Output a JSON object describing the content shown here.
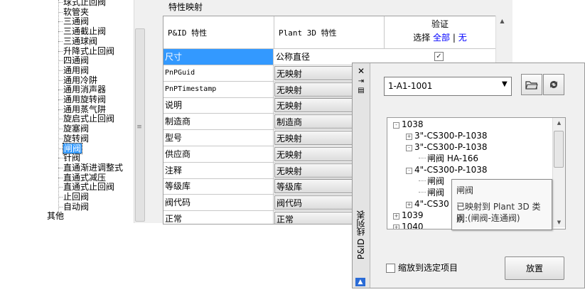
{
  "tree": {
    "items": [
      "球式止回阀",
      "软管夹",
      "三通阀",
      "三通截止阀",
      "三通球阀",
      "升降式止回阀",
      "四通阀",
      "通用阀",
      "通用冷阱",
      "通用消声器",
      "通用旋转阀",
      "通用蒸气阱",
      "旋启式止回阀",
      "旋塞阀",
      "旋转阀",
      "闸阀",
      "针阀",
      "直通渐进调整式",
      "直通式减压",
      "直通式止回阀",
      "止回阀",
      "自动阀",
      "其他"
    ],
    "selected_index": 15
  },
  "properties": {
    "section_title": "特性映射",
    "col_pid": "P&ID 特性",
    "col_plant": "Plant 3D 特性",
    "col_verify": "验证",
    "select_label": "选择",
    "select_all": "全部",
    "sep": "|",
    "select_none": "无",
    "rows": [
      {
        "pid": "尺寸",
        "plant": "公称直径",
        "checked": true
      },
      {
        "pid": "PnPGuid",
        "plant": "无映射"
      },
      {
        "pid": "PnPTimestamp",
        "plant": "无映射"
      },
      {
        "pid": "说明",
        "plant": "无映射"
      },
      {
        "pid": "制造商",
        "plant": "制造商"
      },
      {
        "pid": "型号",
        "plant": "无映射"
      },
      {
        "pid": "供应商",
        "plant": "无映射"
      },
      {
        "pid": "注释",
        "plant": "无映射"
      },
      {
        "pid": "等级库",
        "plant": "等级库"
      },
      {
        "pid": "阀代码",
        "plant": "阀代码"
      },
      {
        "pid": "正常",
        "plant": "正常"
      }
    ]
  },
  "palette": {
    "title": "P&ID 线列表",
    "close_glyph": "✕",
    "drawing_select": "1-A1-1001",
    "tree": [
      {
        "label": "1038",
        "box": "-",
        "level": 0
      },
      {
        "label": "3\"-CS300-P-1038",
        "box": "+",
        "level": 1
      },
      {
        "label": "3\"-CS300-P-1038",
        "box": "-",
        "level": 1
      },
      {
        "label": "闸阀 HA-166",
        "box": "",
        "level": 2
      },
      {
        "label": "4\"-CS300-P-1038",
        "box": "-",
        "level": 1
      },
      {
        "label": "闸阀",
        "box": "",
        "level": 2
      },
      {
        "label": "闸阀",
        "box": "",
        "level": 2
      },
      {
        "label": "4\"-CS30",
        "box": "+",
        "level": 1
      },
      {
        "label": "1039",
        "box": "+",
        "level": 0
      },
      {
        "label": "1040",
        "box": "+",
        "level": 0
      }
    ],
    "tooltip": {
      "title": "闸阀",
      "line1": "已映射到 Plant 3D 类别:",
      "line2": "阀 (闸阀-连通阀)"
    },
    "zoom_label": "缩放到选定项目",
    "place_label": "放置"
  },
  "colors": {
    "selection": "#3399ff",
    "link": "#0000ff"
  }
}
